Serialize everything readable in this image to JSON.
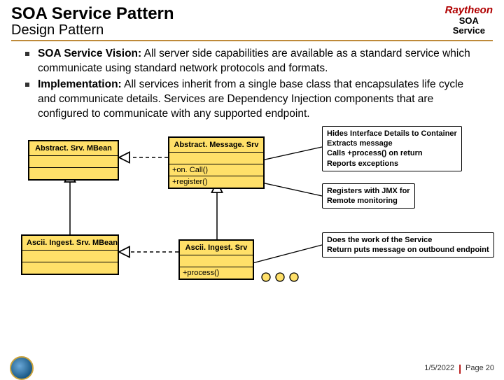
{
  "header": {
    "title": "SOA Service Pattern",
    "subtitle": "Design Pattern",
    "brand": "Raytheon",
    "brand_sub1": "SOA",
    "brand_sub2": "Service"
  },
  "bullets": [
    {
      "lead": "SOA Service Vision:",
      "rest": "  All server side capabilities are available as a standard service which communicate using standard network protocols and formats."
    },
    {
      "lead": "Implementation:",
      "rest": "  All services inherit from a single base class that encapsulates life cycle and communicate details.  Services are Dependency Injection components that are configured to communicate with any supported endpoint."
    }
  ],
  "uml": {
    "abstractSrvMBean": {
      "name": "Abstract. Srv. MBean"
    },
    "abstractMessageSrv": {
      "name": "Abstract. Message. Srv",
      "ops": [
        "+on. Call()",
        "+register()"
      ]
    },
    "asciiIngestSrvMBean": {
      "name": "Ascii. Ingest. Srv. MBean"
    },
    "asciiIngestSrv": {
      "name": "Ascii. Ingest. Srv",
      "ops": [
        "+process()"
      ]
    }
  },
  "notes": {
    "note1": [
      "Hides Interface Details to Container",
      "Extracts message",
      "Calls +process() on return",
      "Reports exceptions"
    ],
    "note2": [
      "Registers with JMX for",
      "Remote monitoring"
    ],
    "note3": [
      "Does the work of the Service",
      "Return puts message on outbound endpoint"
    ]
  },
  "footer": {
    "date": "1/5/2022",
    "page": "Page 20"
  }
}
